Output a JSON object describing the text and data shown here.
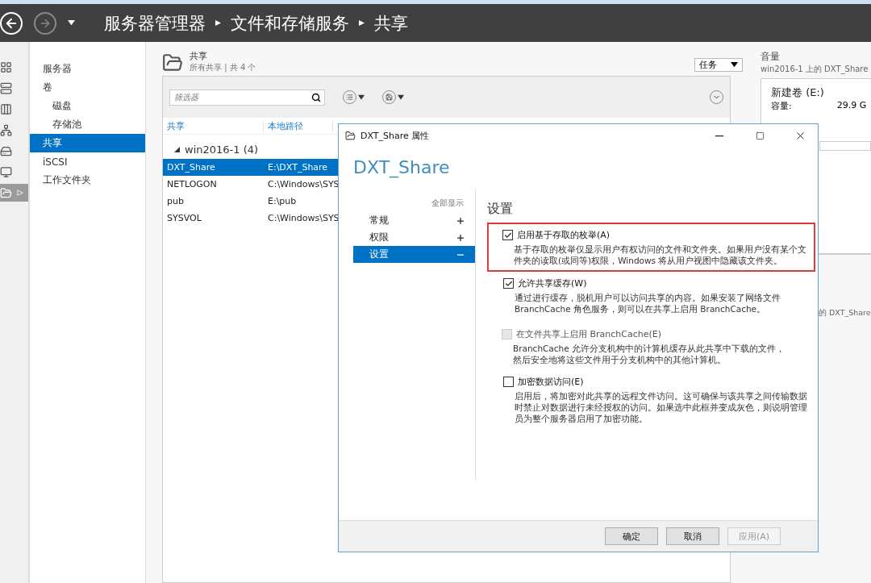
{
  "breadcrumb": [
    "服务器管理器",
    "文件和存储服务",
    "共享"
  ],
  "rail": [
    {
      "kind": "dashboard",
      "selected": false
    },
    {
      "kind": "server",
      "selected": false
    },
    {
      "kind": "servers",
      "selected": false
    },
    {
      "kind": "cluster",
      "selected": false
    },
    {
      "kind": "storage",
      "selected": false
    },
    {
      "kind": "remote",
      "selected": false
    },
    {
      "kind": "files",
      "selected": true
    }
  ],
  "nav": [
    {
      "label": "服务器",
      "selected": false
    },
    {
      "label": "卷",
      "selected": false,
      "children": [
        {
          "label": "磁盘",
          "selected": false
        },
        {
          "label": "存储池",
          "selected": false
        }
      ]
    },
    {
      "label": "共享",
      "selected": true
    },
    {
      "label": "iSCSI",
      "selected": false
    },
    {
      "label": "工作文件夹",
      "selected": false
    }
  ],
  "shares": {
    "title": "共享",
    "subtitle": "所有共享 | 共 4 个",
    "tasks_button": "任务",
    "filter": {
      "placeholder": "筛选器"
    },
    "columns": [
      "共享",
      "本地路径"
    ],
    "groups": [
      {
        "name": "win2016-1 (4)",
        "expanded": true,
        "rows": [
          {
            "cells": [
              "DXT_Share",
              "E:\\DXT_Share"
            ],
            "selected": true
          },
          {
            "cells": [
              "NETLOGON",
              "C:\\Windows\\SYS"
            ],
            "selected": false
          },
          {
            "cells": [
              "pub",
              "E:\\pub"
            ],
            "selected": false
          },
          {
            "cells": [
              "SYSVOL",
              "C:\\Windows\\SYS"
            ],
            "selected": false
          }
        ]
      }
    ]
  },
  "volume": {
    "title": "音量",
    "subtitle": "win2016-1 上的 DXT_Share",
    "name": "新建卷 (E:)",
    "capacity_label": "容量:",
    "capacity_value": "29.9 G",
    "lower_subtitle": "的 DXT_Share"
  },
  "dialog": {
    "title": "DXT_Share 属性",
    "heading": "DXT_Share",
    "show_all": "全部显示",
    "sections": [
      {
        "label": "常规",
        "expanded": false,
        "selected": false
      },
      {
        "label": "权限",
        "expanded": false,
        "selected": false
      },
      {
        "label": "设置",
        "expanded": true,
        "selected": true
      }
    ],
    "content_title": "设置",
    "options": [
      {
        "label": "启用基于存取的枚举(A)",
        "checked": true,
        "disabled": false,
        "highlighted": true,
        "description": "基于存取的枚举仅显示用户有权访问的文件和文件夹。如果用户没有某个文件夹的读取(或同等)权限，Windows 将从用户视图中隐藏该文件夹。"
      },
      {
        "label": "允许共享缓存(W)",
        "checked": true,
        "disabled": false,
        "description": "通过进行缓存，脱机用户可以访问共享的内容。如果安装了网络文件 BranchCache 角色服务，则可以在共享上启用 BranchCache。",
        "children": [
          {
            "label": "在文件共享上启用 BranchCache(E)",
            "checked": false,
            "disabled": true,
            "description": "BranchCache 允许分支机构中的计算机缓存从此共享中下载的文件，然后安全地将这些文件用于分支机构中的其他计算机。"
          }
        ]
      },
      {
        "label": "加密数据访问(E)",
        "checked": false,
        "disabled": false,
        "description": "启用后，将加密对此共享的远程文件访问。这可确保与该共享之间传输数据时禁止对数据进行未经授权的访问。如果选中此框并变成灰色，则说明管理员为整个服务器启用了加密功能。"
      }
    ],
    "buttons": [
      {
        "label": "确定",
        "disabled": false
      },
      {
        "label": "取消",
        "disabled": false
      },
      {
        "label": "应用(A)",
        "disabled": true
      }
    ]
  }
}
